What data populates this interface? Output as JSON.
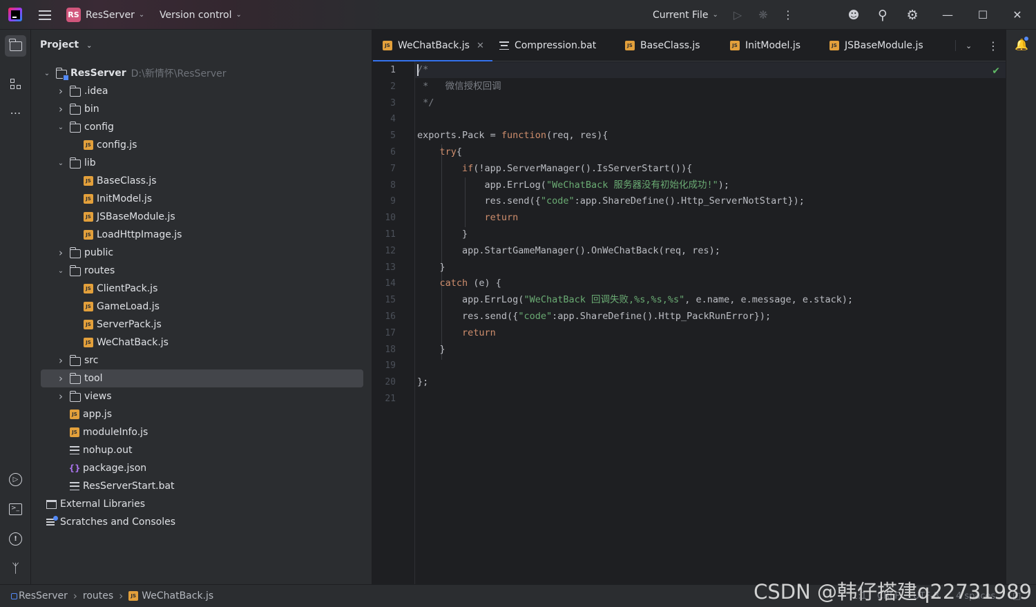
{
  "titlebar": {
    "project_badge": "RS",
    "project_name": "ResServer",
    "vcs_label": "Version control",
    "run_config": "Current File"
  },
  "project_panel": {
    "title": "Project",
    "tree": [
      {
        "label": "ResServer",
        "hint": "D:\\新情怀\\ResServer",
        "type": "module",
        "depth": 0,
        "arrow": "open",
        "bold": true
      },
      {
        "label": ".idea",
        "type": "folder",
        "depth": 1,
        "arrow": "closed"
      },
      {
        "label": "bin",
        "type": "folder",
        "depth": 1,
        "arrow": "closed"
      },
      {
        "label": "config",
        "type": "folder",
        "depth": 1,
        "arrow": "open"
      },
      {
        "label": "config.js",
        "type": "js",
        "depth": 2
      },
      {
        "label": "lib",
        "type": "folder",
        "depth": 1,
        "arrow": "open"
      },
      {
        "label": "BaseClass.js",
        "type": "js",
        "depth": 2
      },
      {
        "label": "InitModel.js",
        "type": "js",
        "depth": 2
      },
      {
        "label": "JSBaseModule.js",
        "type": "js",
        "depth": 2
      },
      {
        "label": "LoadHttpImage.js",
        "type": "js",
        "depth": 2
      },
      {
        "label": "public",
        "type": "folder",
        "depth": 1,
        "arrow": "closed"
      },
      {
        "label": "routes",
        "type": "folder",
        "depth": 1,
        "arrow": "open"
      },
      {
        "label": "ClientPack.js",
        "type": "js",
        "depth": 2
      },
      {
        "label": "GameLoad.js",
        "type": "js",
        "depth": 2
      },
      {
        "label": "ServerPack.js",
        "type": "js",
        "depth": 2
      },
      {
        "label": "WeChatBack.js",
        "type": "js",
        "depth": 2
      },
      {
        "label": "src",
        "type": "folder",
        "depth": 1,
        "arrow": "closed"
      },
      {
        "label": "tool",
        "type": "folder",
        "depth": 1,
        "arrow": "closed",
        "selected": true
      },
      {
        "label": "views",
        "type": "folder",
        "depth": 1,
        "arrow": "closed"
      },
      {
        "label": "app.js",
        "type": "js",
        "depth": 1
      },
      {
        "label": "moduleInfo.js",
        "type": "js",
        "depth": 1
      },
      {
        "label": "nohup.out",
        "type": "text",
        "depth": 1
      },
      {
        "label": "package.json",
        "type": "json",
        "depth": 1
      },
      {
        "label": "ResServerStart.bat",
        "type": "text",
        "depth": 1
      },
      {
        "label": "External Libraries",
        "type": "lib",
        "depth": 0
      },
      {
        "label": "Scratches and Consoles",
        "type": "scratch",
        "depth": 0
      }
    ]
  },
  "tabs": [
    {
      "label": "WeChatBack.js",
      "icon": "js",
      "active": true,
      "closable": true
    },
    {
      "label": "Compression.bat",
      "icon": "text"
    },
    {
      "label": "BaseClass.js",
      "icon": "js"
    },
    {
      "label": "InitModel.js",
      "icon": "js"
    },
    {
      "label": "JSBaseModule.js",
      "icon": "js"
    }
  ],
  "editor": {
    "line_numbers": [
      "1",
      "2",
      "3",
      "4",
      "5",
      "6",
      "7",
      "8",
      "9",
      "10",
      "11",
      "12",
      "13",
      "14",
      "15",
      "16",
      "17",
      "18",
      "19",
      "20",
      "21"
    ],
    "lines": [
      [
        {
          "t": "/*",
          "c": "com"
        }
      ],
      [
        {
          "t": " *   微信授权回调",
          "c": "com"
        }
      ],
      [
        {
          "t": " */",
          "c": "com"
        }
      ],
      [],
      [
        {
          "t": "exports.Pack = "
        },
        {
          "t": "function",
          "c": "kw"
        },
        {
          "t": "(req, res){"
        }
      ],
      [
        {
          "t": "    "
        },
        {
          "t": "try",
          "c": "kw"
        },
        {
          "t": "{"
        }
      ],
      [
        {
          "t": "        "
        },
        {
          "t": "if",
          "c": "kw"
        },
        {
          "t": "(!app.ServerManager().IsServerStart()){"
        }
      ],
      [
        {
          "t": "            app.ErrLog("
        },
        {
          "t": "\"WeChatBack 服务器没有初始化成功!\"",
          "c": "str"
        },
        {
          "t": ");"
        }
      ],
      [
        {
          "t": "            res.send({"
        },
        {
          "t": "\"code\"",
          "c": "str"
        },
        {
          "t": ":app.ShareDefine().Http_ServerNotStart});"
        }
      ],
      [
        {
          "t": "            "
        },
        {
          "t": "return",
          "c": "kw"
        }
      ],
      [
        {
          "t": "        }"
        }
      ],
      [
        {
          "t": "        app.StartGameManager().OnWeChatBack(req, res);"
        }
      ],
      [
        {
          "t": "    }"
        }
      ],
      [
        {
          "t": "    "
        },
        {
          "t": "catch",
          "c": "kw"
        },
        {
          "t": " (e) {"
        }
      ],
      [
        {
          "t": "        app.ErrLog("
        },
        {
          "t": "\"WeChatBack 回调失败,%s,%s,%s\"",
          "c": "str"
        },
        {
          "t": ", e.name, e.message, e.stack);"
        }
      ],
      [
        {
          "t": "        res.send({"
        },
        {
          "t": "\"code\"",
          "c": "str"
        },
        {
          "t": ":app.ShareDefine().Http_PackRunError});"
        }
      ],
      [
        {
          "t": "        "
        },
        {
          "t": "return",
          "c": "kw"
        }
      ],
      [
        {
          "t": "    }"
        }
      ],
      [],
      [
        {
          "t": "};"
        }
      ],
      []
    ]
  },
  "breadcrumbs": [
    "ResServer",
    "routes",
    "WeChatBack.js"
  ],
  "statusbar": {
    "position": "1:1",
    "line_sep": "CRLF",
    "encoding": "UTF-8",
    "indent": "4 spaces"
  },
  "watermark": "CSDN @韩仔搭建q22731989",
  "colors": {
    "accent": "#3574f0",
    "keyword": "#cf8e6d",
    "string": "#6aab73",
    "comment": "#7a7e85"
  }
}
